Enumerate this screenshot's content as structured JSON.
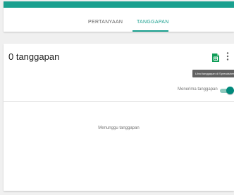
{
  "colors": {
    "accent": "#1aa08f",
    "background": "#f0f0f0",
    "card": "#ffffff"
  },
  "tabs": [
    {
      "label": "PERTANYAAN",
      "active": false
    },
    {
      "label": "TANGGAPAN",
      "active": true
    }
  ],
  "summary": {
    "response_count": "0 tanggapan"
  },
  "actions": {
    "sheets_icon": "google-sheets-icon",
    "more_icon": "more-vert-icon",
    "tooltip": "Lihat tanggapan di Spreadsheet"
  },
  "accepting": {
    "label": "Menerima tanggapan",
    "enabled": true
  },
  "status": {
    "waiting": "Menunggu tanggapan"
  }
}
